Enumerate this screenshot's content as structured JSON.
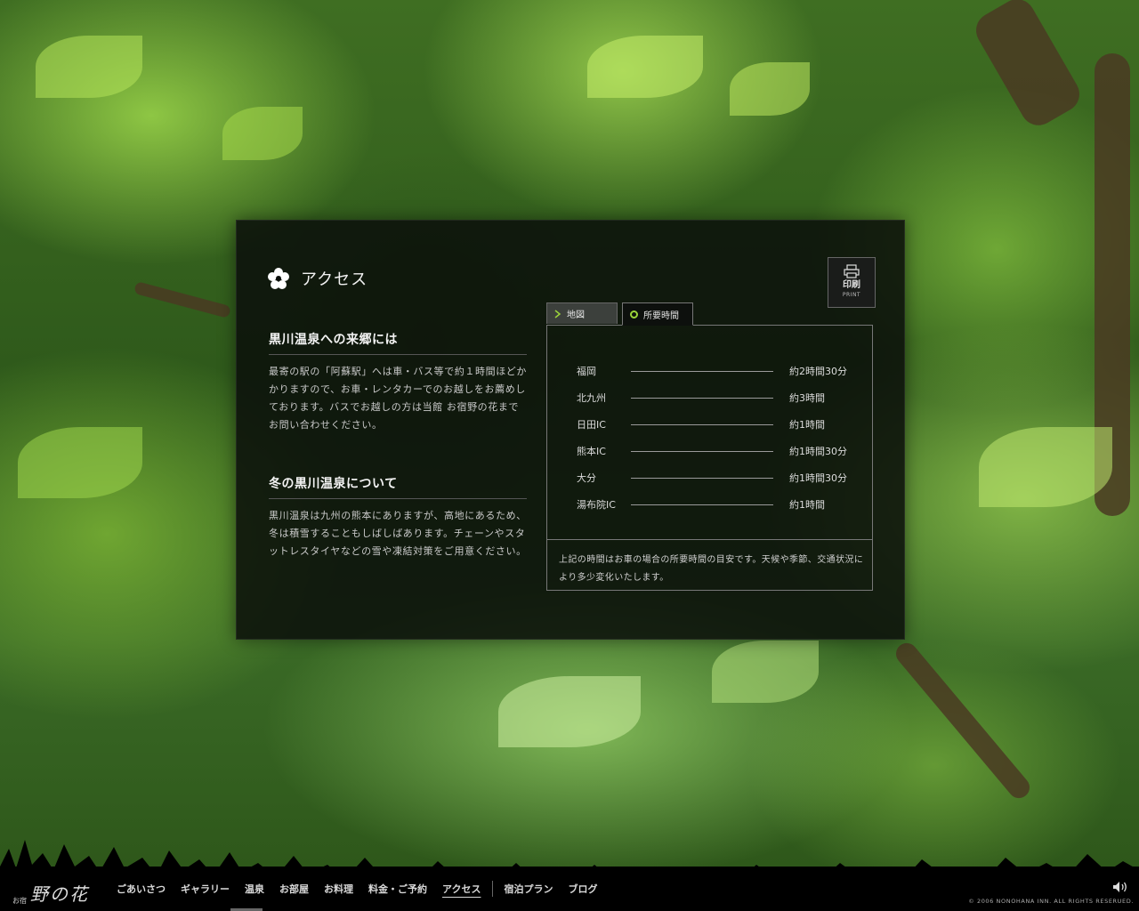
{
  "page": {
    "title": "アクセス",
    "print": {
      "label": "印刷",
      "sub": "PRINT"
    }
  },
  "sections": [
    {
      "heading": "黒川温泉への来郷には",
      "body": "最寄の駅の「阿蘇駅」へは車・バス等で約１時間ほどかかりますので、お車・レンタカーでのお越しをお薦めしております。バスでお越しの方は当館 お宿野の花までお問い合わせください。"
    },
    {
      "heading": "冬の黒川温泉について",
      "body": "黒川温泉は九州の熊本にありますが、高地にあるため、冬は積雪することもしばしばあります。チェーンやスタットレスタイヤなどの雪や凍結対策をご用意ください。"
    }
  ],
  "tabs": {
    "map": "地図",
    "time": "所要時間"
  },
  "travel_times": [
    {
      "dest": "福岡",
      "time": "約2時間30分"
    },
    {
      "dest": "北九州",
      "time": "約3時間"
    },
    {
      "dest": "日田IC",
      "time": "約1時間"
    },
    {
      "dest": "熊本IC",
      "time": "約1時間30分"
    },
    {
      "dest": "大分",
      "time": "約1時間30分"
    },
    {
      "dest": "湯布院IC",
      "time": "約1時間"
    }
  ],
  "note": "上記の時間はお車の場合の所要時間の目安です。天候や季節、交通状況により多少変化いたします。",
  "footer": {
    "logo_small": "お宿",
    "logo_main": "野の花",
    "nav": [
      "ごあいさつ",
      "ギャラリー",
      "温泉",
      "お部屋",
      "お料理",
      "料金・ご予約",
      "アクセス",
      "宿泊プラン",
      "ブログ"
    ],
    "copyright": "© 2006 NONOHANA INN. ALL RIGHTS RESERUED."
  },
  "colors": {
    "accent": "#9bd33a",
    "panel": "#0a0e0a"
  },
  "icons": [
    "flower-icon",
    "print-icon",
    "chevron-right-icon",
    "circle-icon",
    "sound-icon"
  ]
}
